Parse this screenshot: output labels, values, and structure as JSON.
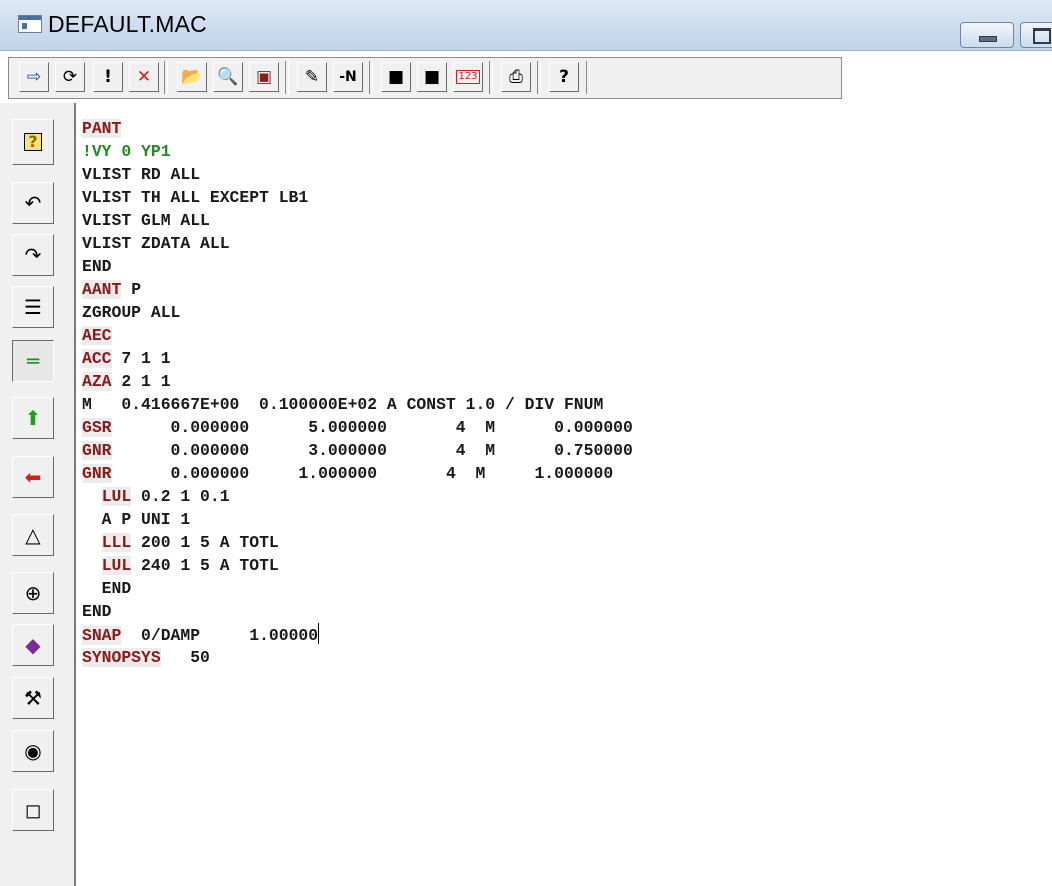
{
  "window": {
    "title": "DEFAULT.MAC"
  },
  "toolbar": {
    "buttons": [
      {
        "icon": "exit-icon",
        "glyph": "⇨",
        "color": "#1d3f8f"
      },
      {
        "icon": "refresh-icon",
        "glyph": "⟳",
        "color": "#000000"
      },
      {
        "icon": "exclamation-icon",
        "glyph": "!",
        "color": "#000000"
      },
      {
        "icon": "red-x-icon",
        "glyph": "✕",
        "color": "#d81b1b"
      },
      {
        "icon": "open-folder-icon",
        "glyph": "📂",
        "color": "#c9a400"
      },
      {
        "icon": "magnifier-icon",
        "glyph": "🔍",
        "color": "#1d3f8f"
      },
      {
        "icon": "macro-icon",
        "glyph": "▣",
        "color": "#8b1a1a"
      },
      {
        "icon": "edit-note-icon",
        "glyph": "✎",
        "color": "#000000"
      },
      {
        "icon": "minus-n-icon",
        "glyph": "-N",
        "color": "#000000"
      },
      {
        "icon": "save-icon",
        "glyph": "■",
        "color": "#000000"
      },
      {
        "icon": "save-as-icon",
        "glyph": "■",
        "color": "#000000"
      },
      {
        "icon": "numbers-123-icon",
        "glyph": "123",
        "color": "#d81b1b"
      },
      {
        "icon": "printer-icon",
        "glyph": "⎙",
        "color": "#000000"
      },
      {
        "icon": "help-icon",
        "glyph": "?",
        "color": "#000000"
      }
    ]
  },
  "sidebar": {
    "buttons": [
      {
        "icon": "help-question-icon",
        "glyph": "?",
        "color": "#8a6a00"
      },
      {
        "icon": "undo-icon",
        "glyph": "↶",
        "color": "#000000"
      },
      {
        "icon": "redo-icon",
        "glyph": "↷",
        "color": "#000000"
      },
      {
        "icon": "indent-icon",
        "glyph": "☰",
        "color": "#000000"
      },
      {
        "icon": "equals-lines-icon",
        "glyph": "═",
        "color": "#1a8f1a"
      },
      {
        "icon": "green-up-arrow-icon",
        "glyph": "⬆",
        "color": "#1aa11a"
      },
      {
        "icon": "red-left-arrow-icon",
        "glyph": "⬅",
        "color": "#d81b1b"
      },
      {
        "icon": "triangle-icon",
        "glyph": "△",
        "color": "#000000"
      },
      {
        "icon": "crosshair-circle-icon",
        "glyph": "⊕",
        "color": "#000000"
      },
      {
        "icon": "gem-icon",
        "glyph": "◆",
        "color": "#7a2a9a"
      },
      {
        "icon": "wrench-icon",
        "glyph": "⚒",
        "color": "#000000"
      },
      {
        "icon": "eye-icon",
        "glyph": "◉",
        "color": "#000000"
      },
      {
        "icon": "exit-door-icon",
        "glyph": "◻",
        "color": "#000000"
      }
    ]
  },
  "editor": {
    "lines": [
      {
        "kw": "PANT",
        "rest": ""
      },
      {
        "comment": "!VY 0 YP1"
      },
      {
        "kw": "",
        "rest": "VLIST RD ALL"
      },
      {
        "kw": "",
        "rest": "VLIST TH ALL EXCEPT LB1"
      },
      {
        "kw": "",
        "rest": "VLIST GLM ALL"
      },
      {
        "kw": "",
        "rest": "VLIST ZDATA ALL"
      },
      {
        "kw": "",
        "rest": "END"
      },
      {
        "kw": "AANT",
        "rest": " P"
      },
      {
        "kw": "",
        "rest": "ZGROUP ALL"
      },
      {
        "kw": "AEC",
        "rest": ""
      },
      {
        "kw": "ACC",
        "rest": " 7 1 1"
      },
      {
        "kw": "AZA",
        "rest": " 2 1 1"
      },
      {
        "kw": "",
        "rest": "M   0.416667E+00  0.100000E+02 A CONST 1.0 / DIV FNUM"
      },
      {
        "kw": "GSR",
        "rest": "      0.000000      5.000000       4  M      0.000000"
      },
      {
        "kw": "GNR",
        "rest": "      0.000000      3.000000       4  M      0.750000"
      },
      {
        "kw": "GNR",
        "rest": "      0.000000     1.000000       4  M     1.000000"
      },
      {
        "indent": "  ",
        "kw": "LUL",
        "rest": " 0.2 1 0.1"
      },
      {
        "kw": "",
        "rest": "  A P UNI 1"
      },
      {
        "indent": "  ",
        "kw": "LLL",
        "rest": " 200 1 5 A TOTL"
      },
      {
        "indent": "  ",
        "kw": "LUL",
        "rest": " 240 1 5 A TOTL"
      },
      {
        "kw": "",
        "rest": "  END"
      },
      {
        "kw": "",
        "rest": "END"
      },
      {
        "kw": "SNAP",
        "rest": "  0/DAMP     1.00000",
        "caret": true
      },
      {
        "kw": "SYNOPSYS",
        "rest": "   50"
      }
    ]
  }
}
